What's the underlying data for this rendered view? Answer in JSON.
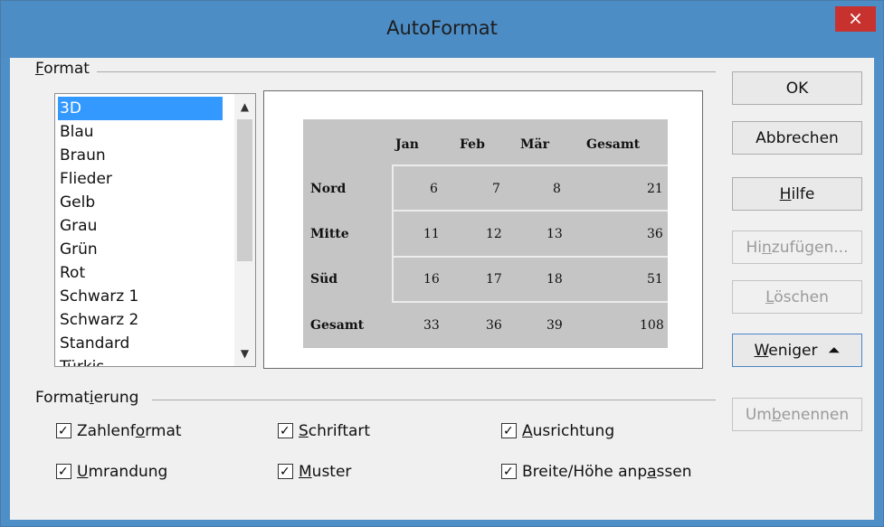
{
  "window": {
    "title": "AutoFormat",
    "close_symbol": "×"
  },
  "format_group": {
    "label": "Format",
    "items": [
      "3D",
      "Blau",
      "Braun",
      "Flieder",
      "Gelb",
      "Grau",
      "Grün",
      "Rot",
      "Schwarz 1",
      "Schwarz 2",
      "Standard",
      "Türkis"
    ],
    "selected": "3D"
  },
  "preview": {
    "columns": [
      "Jan",
      "Feb",
      "Mär",
      "Gesamt"
    ],
    "rows": [
      {
        "label": "Nord",
        "values": [
          "6",
          "7",
          "8",
          "21"
        ]
      },
      {
        "label": "Mitte",
        "values": [
          "11",
          "12",
          "13",
          "36"
        ]
      },
      {
        "label": "Süd",
        "values": [
          "16",
          "17",
          "18",
          "51"
        ]
      },
      {
        "label": "Gesamt",
        "values": [
          "33",
          "36",
          "39",
          "108"
        ]
      }
    ]
  },
  "buttons": {
    "ok": "OK",
    "cancel": "Abbrechen",
    "help": "Hilfe",
    "add": "Hinzufügen...",
    "delete": "Löschen",
    "fewer": "Weniger",
    "rename": "Umbenennen"
  },
  "formatting_group": {
    "label": "Formatierung",
    "options": {
      "number_format": "Zahlenformat",
      "borders": "Umrandung",
      "font": "Schriftart",
      "pattern": "Muster",
      "alignment": "Ausrichtung",
      "autofit": "Breite/Höhe anpassen"
    }
  },
  "colors": {
    "titlebar": "#4d8dc6",
    "close": "#c7312e",
    "selection": "#3399ff",
    "preview_bg": "#c5c5c5"
  }
}
